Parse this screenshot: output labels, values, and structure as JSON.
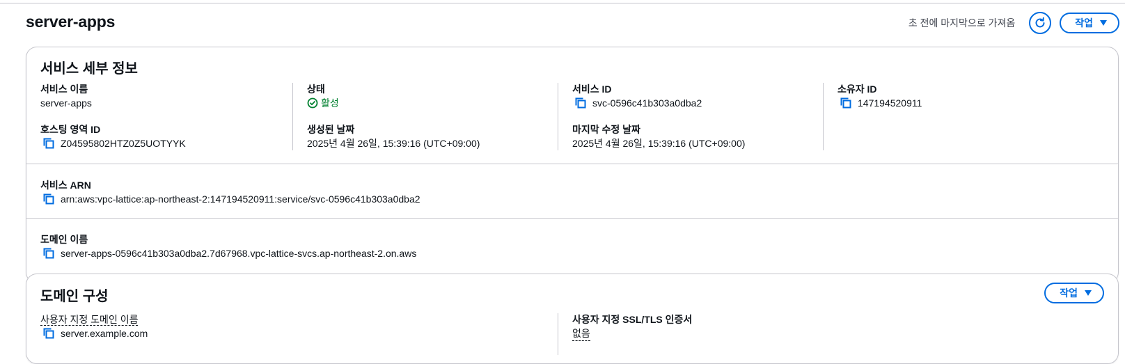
{
  "page": {
    "title": "server-apps",
    "fetched_text": "초 전에 마지막으로 가져옴",
    "actions_label": "작업"
  },
  "service_details": {
    "title": "서비스 세부 정보",
    "name_label": "서비스 이름",
    "name_value": "server-apps",
    "hosted_zone_label": "호스팅 영역 ID",
    "hosted_zone_value": "Z04595802HTZ0Z5UOTYYK",
    "status_label": "상태",
    "status_value": "활성",
    "created_label": "생성된 날짜",
    "created_value": "2025년 4월 26일, 15:39:16 (UTC+09:00)",
    "service_id_label": "서비스 ID",
    "service_id_value": "svc-0596c41b303a0dba2",
    "modified_label": "마지막 수정 날짜",
    "modified_value": "2025년 4월 26일, 15:39:16 (UTC+09:00)",
    "owner_label": "소유자 ID",
    "owner_value": "147194520911",
    "arn_label": "서비스 ARN",
    "arn_value": "arn:aws:vpc-lattice:ap-northeast-2:147194520911:service/svc-0596c41b303a0dba2",
    "domain_label": "도메인 이름",
    "domain_value": "server-apps-0596c41b303a0dba2.7d67968.vpc-lattice-svcs.ap-northeast-2.on.aws"
  },
  "domain_config": {
    "title": "도메인 구성",
    "actions_label": "작업",
    "custom_domain_label": "사용자 지정 도메인 이름",
    "custom_domain_value": "server.example.com",
    "ssl_label": "사용자 지정 SSL/TLS 인증서",
    "ssl_value": "없음"
  },
  "colors": {
    "accent": "#006ce0",
    "success": "#00802f",
    "border": "#c6c6cd"
  },
  "icons": [
    "refresh-icon",
    "caret-down-icon",
    "copy-icon",
    "status-check-icon"
  ]
}
